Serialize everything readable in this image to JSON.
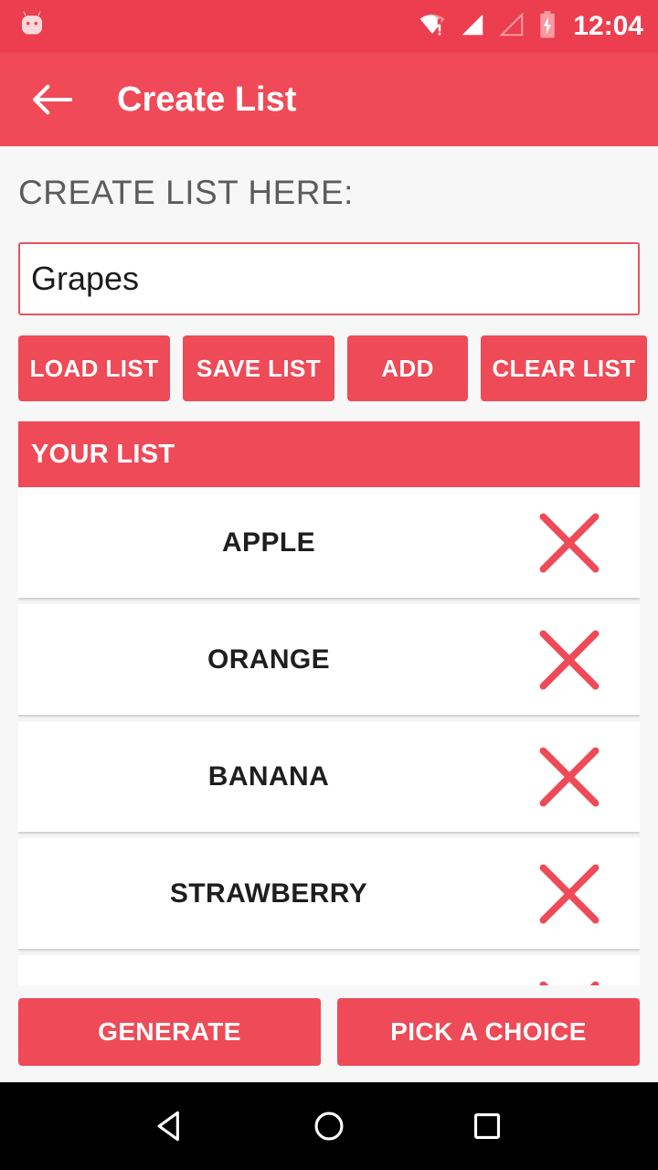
{
  "status_bar": {
    "android_icon": "android-head-icon",
    "wifi_icon": "wifi-no-internet-icon",
    "signal_full_icon": "signal-full-icon",
    "signal_empty_icon": "signal-empty-icon",
    "battery_icon": "battery-charging-icon",
    "clock": "12:04",
    "background_color": "#EC3E4F"
  },
  "toolbar": {
    "back_icon": "back-arrow-icon",
    "title": "Create List",
    "background_color": "#F04A58"
  },
  "main": {
    "section_label": "CREATE LIST HERE:",
    "input": {
      "value": "Grapes",
      "placeholder": "",
      "border_color": "#E8535F"
    },
    "actions": [
      {
        "label": "LOAD LIST",
        "name": "load-list-button"
      },
      {
        "label": "SAVE LIST",
        "name": "save-list-button"
      },
      {
        "label": "ADD",
        "name": "add-button"
      },
      {
        "label": "CLEAR LIST",
        "name": "clear-list-button"
      }
    ],
    "list_header": "YOUR LIST",
    "list_items": [
      {
        "label": "APPLE",
        "delete_icon": "delete-x-icon"
      },
      {
        "label": "ORANGE",
        "delete_icon": "delete-x-icon"
      },
      {
        "label": "BANANA",
        "delete_icon": "delete-x-icon"
      },
      {
        "label": "STRAWBERRY",
        "delete_icon": "delete-x-icon"
      },
      {
        "label": "",
        "delete_icon": "delete-x-icon"
      }
    ],
    "bottom_actions": [
      {
        "label": "GENERATE",
        "name": "generate-button"
      },
      {
        "label": "PICK A CHOICE",
        "name": "pick-a-choice-button"
      }
    ]
  },
  "nav_bar": {
    "back_icon": "nav-back-triangle-icon",
    "home_icon": "nav-home-circle-icon",
    "recents_icon": "nav-recents-square-icon",
    "background_color": "#000000"
  },
  "theme": {
    "accent": "#EF4A57",
    "page_background": "#F7F7F7",
    "card_background": "#FFFFFF",
    "label_color": "#5C5C5C",
    "item_text_color": "#1E1E1E"
  }
}
